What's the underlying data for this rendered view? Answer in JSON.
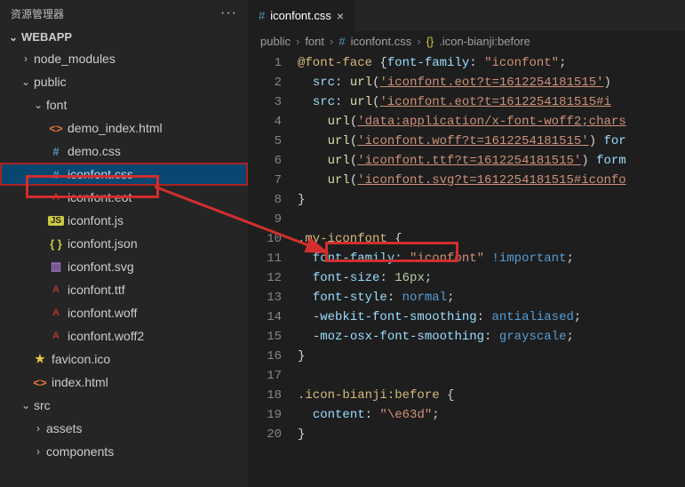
{
  "sidebar": {
    "title": "资源管理器",
    "root": "WEBAPP",
    "items": [
      {
        "name": "node_modules",
        "type": "folder",
        "depth": 1,
        "expanded": false
      },
      {
        "name": "public",
        "type": "folder",
        "depth": 1,
        "expanded": true
      },
      {
        "name": "font",
        "type": "folder",
        "depth": 2,
        "expanded": true
      },
      {
        "name": "demo_index.html",
        "type": "html",
        "depth": 3
      },
      {
        "name": "demo.css",
        "type": "css",
        "depth": 3
      },
      {
        "name": "iconfont.css",
        "type": "css",
        "depth": 3,
        "selected": true
      },
      {
        "name": "iconfont.eot",
        "type": "font",
        "depth": 3
      },
      {
        "name": "iconfont.js",
        "type": "js",
        "depth": 3
      },
      {
        "name": "iconfont.json",
        "type": "json",
        "depth": 3
      },
      {
        "name": "iconfont.svg",
        "type": "svg",
        "depth": 3
      },
      {
        "name": "iconfont.ttf",
        "type": "font",
        "depth": 3
      },
      {
        "name": "iconfont.woff",
        "type": "font",
        "depth": 3
      },
      {
        "name": "iconfont.woff2",
        "type": "font",
        "depth": 3
      },
      {
        "name": "favicon.ico",
        "type": "star",
        "depth": 2
      },
      {
        "name": "index.html",
        "type": "html",
        "depth": 2
      },
      {
        "name": "src",
        "type": "folder",
        "depth": 1,
        "expanded": true
      },
      {
        "name": "assets",
        "type": "folder",
        "depth": 2,
        "expanded": false
      },
      {
        "name": "components",
        "type": "folder",
        "depth": 2,
        "expanded": false
      }
    ]
  },
  "tabs": [
    {
      "icon": "#",
      "label": "iconfont.css"
    }
  ],
  "breadcrumb": [
    "public",
    "font",
    "iconfont.css",
    ".icon-bianji:before"
  ],
  "code": {
    "start": 1,
    "lines": [
      [
        [
          "sel",
          "@font-face "
        ],
        [
          "brace",
          "{"
        ],
        [
          "prop",
          "font-family"
        ],
        [
          "brace",
          ": "
        ],
        [
          "str",
          "\"iconfont\""
        ],
        [
          "brace",
          ";"
        ]
      ],
      [
        [
          "pad",
          "  "
        ],
        [
          "prop",
          "src"
        ],
        [
          "brace",
          ": "
        ],
        [
          "func",
          "url"
        ],
        [
          "brace",
          "("
        ],
        [
          "und",
          "'iconfont.eot?t=1612254181515'"
        ],
        [
          "brace",
          ")"
        ]
      ],
      [
        [
          "pad",
          "  "
        ],
        [
          "prop",
          "src"
        ],
        [
          "brace",
          ": "
        ],
        [
          "func",
          "url"
        ],
        [
          "brace",
          "("
        ],
        [
          "und",
          "'iconfont.eot?t=1612254181515#i"
        ]
      ],
      [
        [
          "pad",
          "    "
        ],
        [
          "func",
          "url"
        ],
        [
          "brace",
          "("
        ],
        [
          "und",
          "'data:application/x-font-woff2;chars"
        ]
      ],
      [
        [
          "pad",
          "    "
        ],
        [
          "func",
          "url"
        ],
        [
          "brace",
          "("
        ],
        [
          "und",
          "'iconfont.woff?t=1612254181515'"
        ],
        [
          "brace",
          ") "
        ],
        [
          "prop",
          "for"
        ]
      ],
      [
        [
          "pad",
          "    "
        ],
        [
          "func",
          "url"
        ],
        [
          "brace",
          "("
        ],
        [
          "und",
          "'iconfont.ttf?t=1612254181515'"
        ],
        [
          "brace",
          ") "
        ],
        [
          "prop",
          "form"
        ]
      ],
      [
        [
          "pad",
          "    "
        ],
        [
          "func",
          "url"
        ],
        [
          "brace",
          "("
        ],
        [
          "und",
          "'iconfont.svg?t=1612254181515#iconfo"
        ]
      ],
      [
        [
          "brace",
          "}"
        ]
      ],
      [],
      [
        [
          "sel",
          ".my-iconfont "
        ],
        [
          "brace",
          "{"
        ]
      ],
      [
        [
          "pad",
          "  "
        ],
        [
          "prop",
          "font-family"
        ],
        [
          "brace",
          ": "
        ],
        [
          "str",
          "\"iconfont\""
        ],
        [
          "brace",
          " "
        ],
        [
          "imp",
          "!important"
        ],
        [
          "brace",
          ";"
        ]
      ],
      [
        [
          "pad",
          "  "
        ],
        [
          "prop",
          "font-size"
        ],
        [
          "brace",
          ": "
        ],
        [
          "num",
          "16px"
        ],
        [
          "brace",
          ";"
        ]
      ],
      [
        [
          "pad",
          "  "
        ],
        [
          "prop",
          "font-style"
        ],
        [
          "brace",
          ": "
        ],
        [
          "kw",
          "normal"
        ],
        [
          "brace",
          ";"
        ]
      ],
      [
        [
          "pad",
          "  "
        ],
        [
          "prop",
          "-webkit-font-smoothing"
        ],
        [
          "brace",
          ": "
        ],
        [
          "kw",
          "antialiased"
        ],
        [
          "brace",
          ";"
        ]
      ],
      [
        [
          "pad",
          "  "
        ],
        [
          "prop",
          "-moz-osx-font-smoothing"
        ],
        [
          "brace",
          ": "
        ],
        [
          "kw",
          "grayscale"
        ],
        [
          "brace",
          ";"
        ]
      ],
      [
        [
          "brace",
          "}"
        ]
      ],
      [],
      [
        [
          "sel",
          ".icon-bianji:before "
        ],
        [
          "brace",
          "{"
        ]
      ],
      [
        [
          "pad",
          "  "
        ],
        [
          "prop",
          "content"
        ],
        [
          "brace",
          ": "
        ],
        [
          "str",
          "\"\\e63d\""
        ],
        [
          "brace",
          ";"
        ]
      ],
      [
        [
          "brace",
          "}"
        ]
      ]
    ]
  }
}
